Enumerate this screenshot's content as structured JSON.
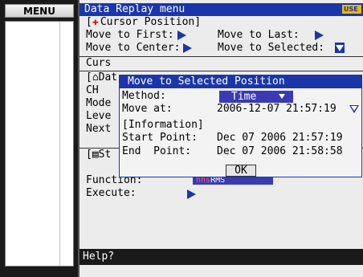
{
  "menu": {
    "label": "MENU"
  },
  "header": {
    "title": "Data Replay menu",
    "badge": "USE"
  },
  "cursor_position": {
    "section_label": "[✚Cursor Position]",
    "section_text": "Cursor Position]",
    "move_first": "Move to First:",
    "move_last": "Move to Last:",
    "move_center": "Move to Center:",
    "move_selected": "Move to Selected:"
  },
  "background_rows": {
    "cursor_partial": "Curs",
    "data_partial": "[⌂Dat",
    "ch": "CH",
    "mode": "Mode",
    "level": "Leve",
    "next": "Next",
    "stats_partial": "[▤St",
    "function_label": "Function:",
    "function_value": "RMS",
    "function_prefix": "hhs",
    "execute_label": "Execute:"
  },
  "dialog": {
    "title": "Move to Selected Position",
    "method_label": "Method:",
    "method_value": "Time",
    "move_at_label": "Move at:",
    "move_at_value": "2006-12-07 21:57:19",
    "info_label": "[Information]",
    "start_label": "Start Point:",
    "start_value": "Dec 07 2006 21:57:19",
    "end_label": "End  Point:",
    "end_value": "Dec 07 2006 21:58:58",
    "ok_label": "OK"
  },
  "help": {
    "label": "Help?"
  }
}
